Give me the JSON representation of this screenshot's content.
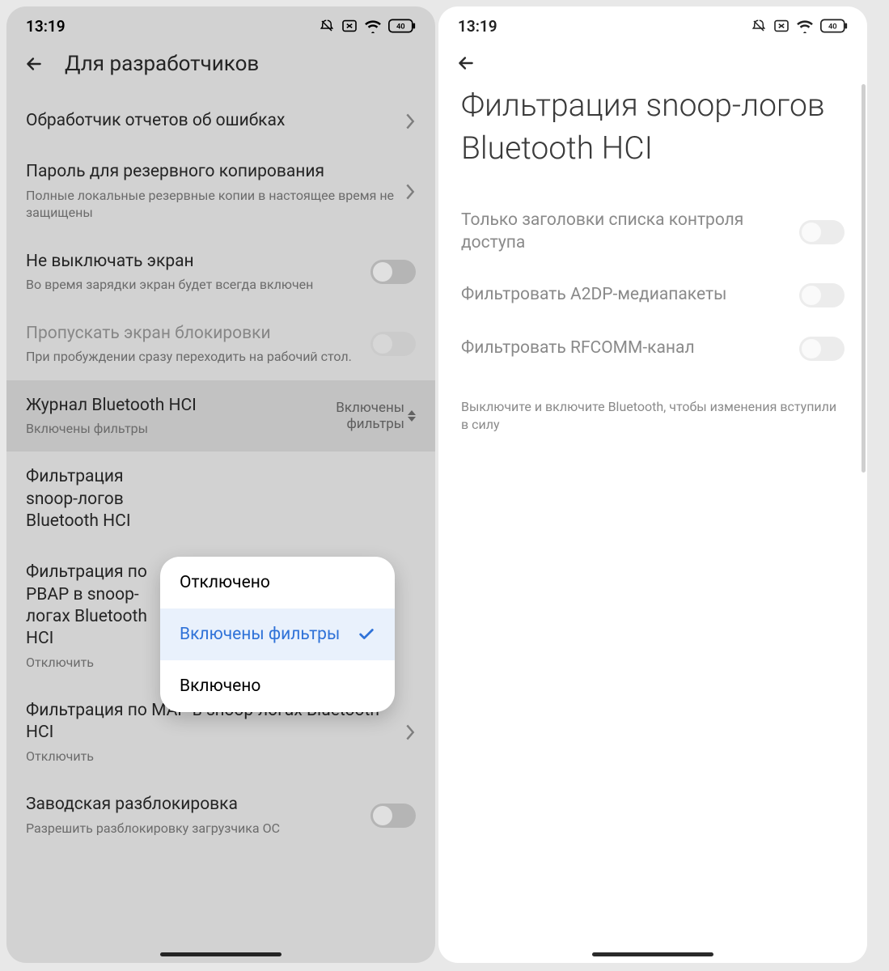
{
  "status_time": "13:19",
  "battery_level": "40",
  "left": {
    "page_title": "Для разработчиков",
    "items": {
      "bug_report": {
        "title": "Обработчик отчетов об ошибках"
      },
      "backup_pw": {
        "title": "Пароль для резервного копирования",
        "sub": "Полные локальные резервные копии в настоящее время не защищены"
      },
      "stay_awake": {
        "title": "Не выключать экран",
        "sub": "Во время зарядки экран будет всегда включен"
      },
      "skip_lock": {
        "title": "Пропускать экран блокировки",
        "sub": "При пробуждении сразу переходить на рабочий стол."
      },
      "hci_log": {
        "title": "Журнал Bluetooth HCI",
        "sub": "Включены фильтры",
        "value_line1": "Включены",
        "value_line2": "фильтры"
      },
      "snoop_filter": {
        "title": "Фильтрация snoop-логов Bluetooth HCI"
      },
      "pbap_filter": {
        "title": "Фильтрация по PBAP в snoop-логах Bluetooth HCI",
        "sub": "Отключить"
      },
      "map_filter": {
        "title": "Фильтрация по MAP в snoop-логах Bluetooth HCI",
        "sub": "Отключить"
      },
      "oem_unlock": {
        "title": "Заводская разблокировка",
        "sub": "Разрешить разблокировку загрузчика ОС"
      }
    },
    "popup": {
      "opt1": "Отключено",
      "opt2": "Включены фильтры",
      "opt3": "Включено"
    }
  },
  "right": {
    "page_title": "Фильтрация snoop-логов Bluetooth HCI",
    "items": {
      "acl_headers": "Только заголовки списка контроля доступа",
      "a2dp": "Фильтровать A2DP-медиапакеты",
      "rfcomm": "Фильтровать RFCOMM-канал"
    },
    "footnote": "Выключите и включите Bluetooth, чтобы изменения вступили в силу"
  }
}
